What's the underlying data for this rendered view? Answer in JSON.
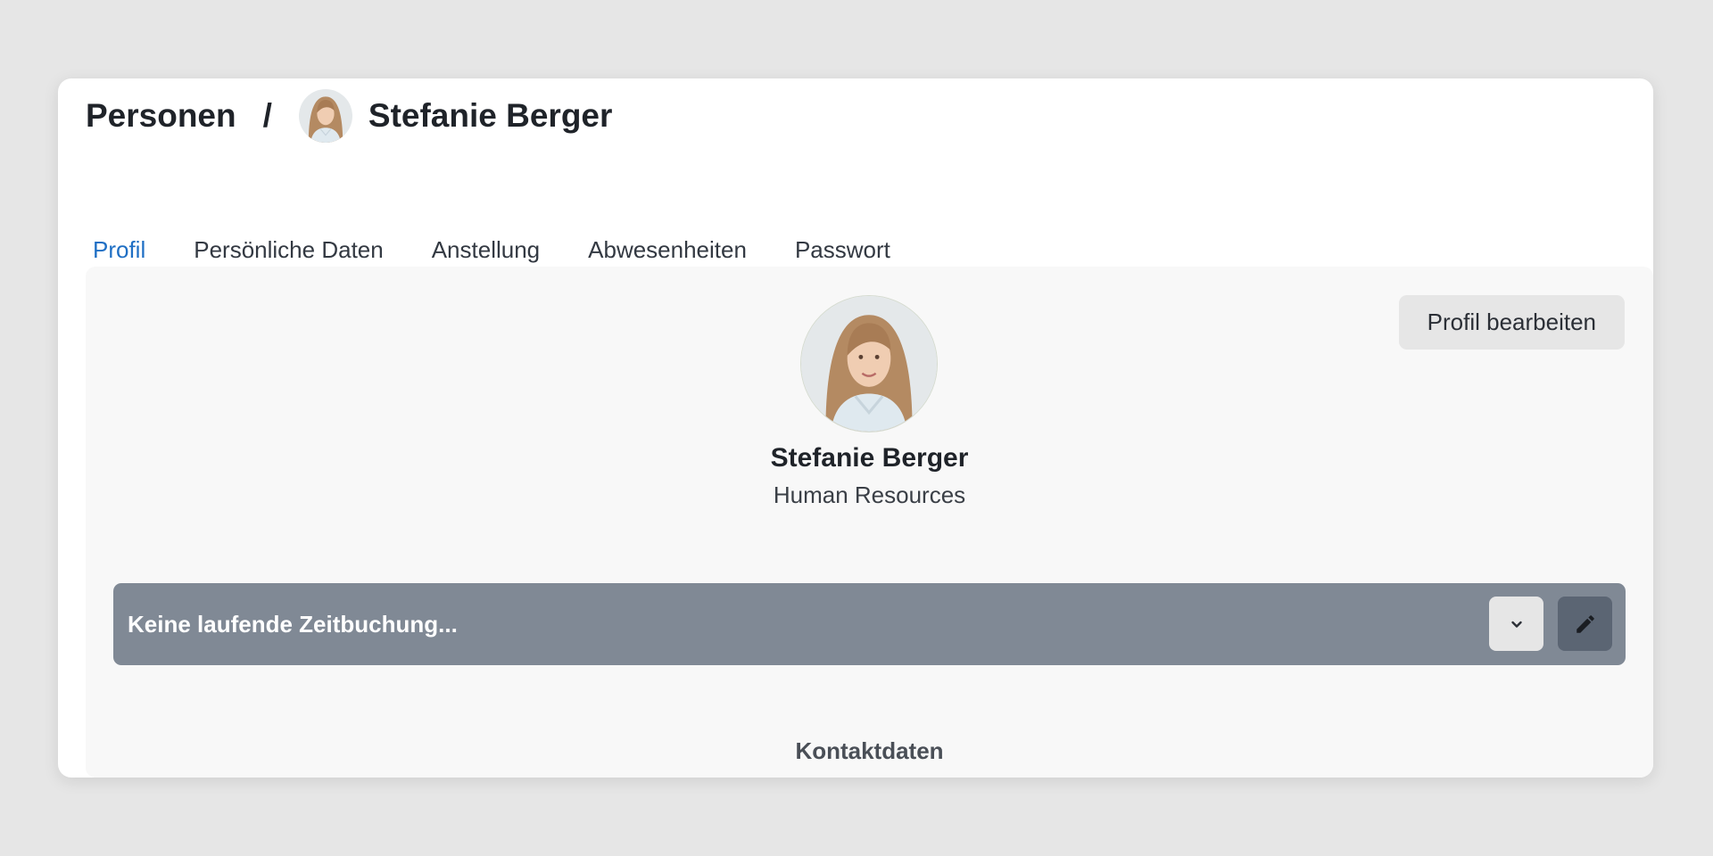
{
  "header": {
    "breadcrumb_root": "Personen",
    "breadcrumb_separator": "/",
    "person_name": "Stefanie Berger"
  },
  "tabs": [
    {
      "label": "Profil",
      "active": true
    },
    {
      "label": "Persönliche Daten",
      "active": false
    },
    {
      "label": "Anstellung",
      "active": false
    },
    {
      "label": "Abwesenheiten",
      "active": false
    },
    {
      "label": "Passwort",
      "active": false
    }
  ],
  "profile": {
    "edit_button_label": "Profil bearbeiten",
    "name": "Stefanie Berger",
    "department": "Human Resources"
  },
  "time_tracking": {
    "status_text": "Keine laufende Zeitbuchung...",
    "expand_icon": "chevron-down-icon",
    "edit_icon": "pencil-icon"
  },
  "contact": {
    "section_title": "Kontaktdaten"
  },
  "colors": {
    "accent": "#1f6fc4",
    "time_bar": "#808995",
    "edit_button_dark": "#5b6573",
    "panel_background": "#f8f8f8",
    "page_background": "#e6e6e6"
  }
}
